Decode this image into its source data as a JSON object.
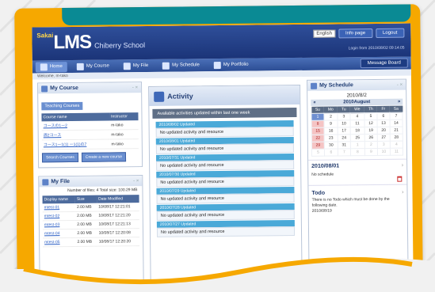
{
  "header": {
    "logo_small": "Sakai",
    "logo_main": "LMS",
    "school": "Chiberry School",
    "lang": "English",
    "btn1": "Info page",
    "btn2": "Logout",
    "login_info": "Login from 2010/08/02 09:14:05"
  },
  "nav": {
    "items": [
      "Home",
      "My Course",
      "My File",
      "My Schedule",
      "My Portfolio"
    ],
    "message": "Message Board"
  },
  "breadcrumb": "Welcome, m-tako",
  "course": {
    "title": "My Course",
    "tab": "Teaching Courses",
    "col1": "Course name",
    "col2": "Instructor",
    "rows": [
      {
        "name": "コースの1ー2",
        "instr": "m-tako"
      },
      {
        "name": "週2コース",
        "instr": "m-tako"
      },
      {
        "name": "コース1ー1(1) ー1(1)の7",
        "instr": "m-tako"
      }
    ],
    "btn_search": "Search Courses",
    "btn_create": "Create a new course"
  },
  "file": {
    "title": "My File",
    "info": "Number of files: 4 Total size: 100.29 MB",
    "cols": [
      "Display name",
      "Size",
      "Date Modified"
    ],
    "rows": [
      {
        "name": "mtest-01",
        "size": "2.00 MB",
        "date": "10/08/17 12:21:01"
      },
      {
        "name": "mtest-02",
        "size": "2.00 MB",
        "date": "10/08/17 12:21:20"
      },
      {
        "name": "mtest-03",
        "size": "2.00 MB",
        "date": "10/08/17 12:21:13"
      },
      {
        "name": "mtest-04",
        "size": "2.00 MB",
        "date": "10/08/17 12:20:08"
      },
      {
        "name": "mtest-05",
        "size": "2.00 MB",
        "date": "10/08/17 12:20:20"
      }
    ]
  },
  "activity": {
    "title": "Activity",
    "note": "Available activities updated within last one week",
    "items": [
      {
        "date": "2010/08/02 Updated",
        "text": "No updated activity and resource"
      },
      {
        "date": "2010/08/01 Updated",
        "text": "No updated activity and resource"
      },
      {
        "date": "2010/07/31 Updated",
        "text": "No updated activity and resource"
      },
      {
        "date": "2010/07/30 Updated",
        "text": "No updated activity and resource"
      },
      {
        "date": "2010/07/29 Updated",
        "text": "No updated activity and resource"
      },
      {
        "date": "2010/07/28 Updated",
        "text": "No updated activity and resource"
      },
      {
        "date": "2010/07/27 Updated",
        "text": "No updated activity and resource"
      }
    ]
  },
  "schedule": {
    "title": "My Schedule",
    "date_title": "2010/8/2",
    "month": "2010August",
    "prev": "«",
    "next": "»",
    "weekdays": [
      "Su",
      "Mo",
      "Tu",
      "We",
      "Th",
      "Fr",
      "Sa"
    ],
    "weeks": [
      [
        "1",
        "2",
        "3",
        "4",
        "5",
        "6",
        "7"
      ],
      [
        "8",
        "9",
        "10",
        "11",
        "12",
        "13",
        "14"
      ],
      [
        "15",
        "16",
        "17",
        "18",
        "19",
        "20",
        "21"
      ],
      [
        "22",
        "23",
        "24",
        "25",
        "26",
        "27",
        "28"
      ],
      [
        "29",
        "30",
        "31",
        "1",
        "2",
        "3",
        "4"
      ],
      [
        "5",
        "6",
        "7",
        "8",
        "9",
        "10",
        "11"
      ]
    ],
    "sel_date": "2010/08/01",
    "none": "No schedule",
    "todo_title": "Todo",
    "todo_text": "There is no Todo which must be done by the following date.",
    "todo_date": "2010/08/19"
  }
}
